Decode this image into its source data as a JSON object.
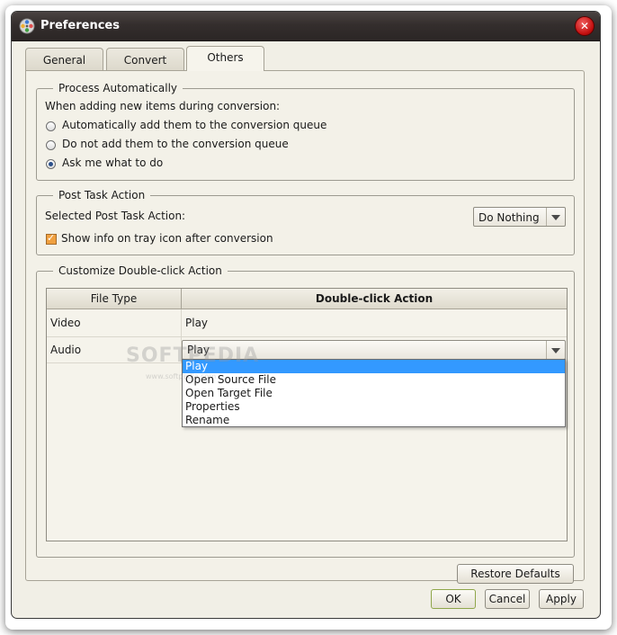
{
  "window": {
    "title": "Preferences",
    "close_glyph": "✕",
    "app_icon": "film-reel-icon"
  },
  "tabs": [
    {
      "label": "General",
      "active": false
    },
    {
      "label": "Convert",
      "active": false
    },
    {
      "label": "Others",
      "active": true
    }
  ],
  "process_automatically": {
    "legend": "Process Automatically",
    "prompt": "When adding new items during conversion:",
    "options": [
      {
        "label": "Automatically add them to the conversion queue",
        "checked": false
      },
      {
        "label": "Do not add them to the conversion queue",
        "checked": false
      },
      {
        "label": "Ask me what to do",
        "checked": true
      }
    ]
  },
  "post_task": {
    "legend": "Post Task Action",
    "label": "Selected Post Task Action:",
    "selected": "Do Nothing",
    "tray_checkbox": {
      "label": "Show info on tray icon after conversion",
      "checked": true
    }
  },
  "double_click": {
    "legend": "Customize Double-click Action",
    "columns": [
      "File Type",
      "Double-click Action"
    ],
    "rows": [
      {
        "type": "Video",
        "action": "Play"
      },
      {
        "type": "Audio",
        "action": "Play"
      }
    ],
    "dropdown_options": [
      "Play",
      "Open Source File",
      "Open Target File",
      "Properties",
      "Rename"
    ],
    "dropdown_selected_index": 0
  },
  "buttons": {
    "restore": "Restore Defaults",
    "ok": "OK",
    "cancel": "Cancel",
    "apply": "Apply"
  },
  "watermark": {
    "text": "SOFTPEDIA",
    "sub": "www.softpedia.com"
  },
  "colors": {
    "titlebar": "#342e2d",
    "dialog_bg": "#f1efe6",
    "selection": "#3399ff",
    "checkbox": "#f0a040",
    "close": "#c41010"
  }
}
